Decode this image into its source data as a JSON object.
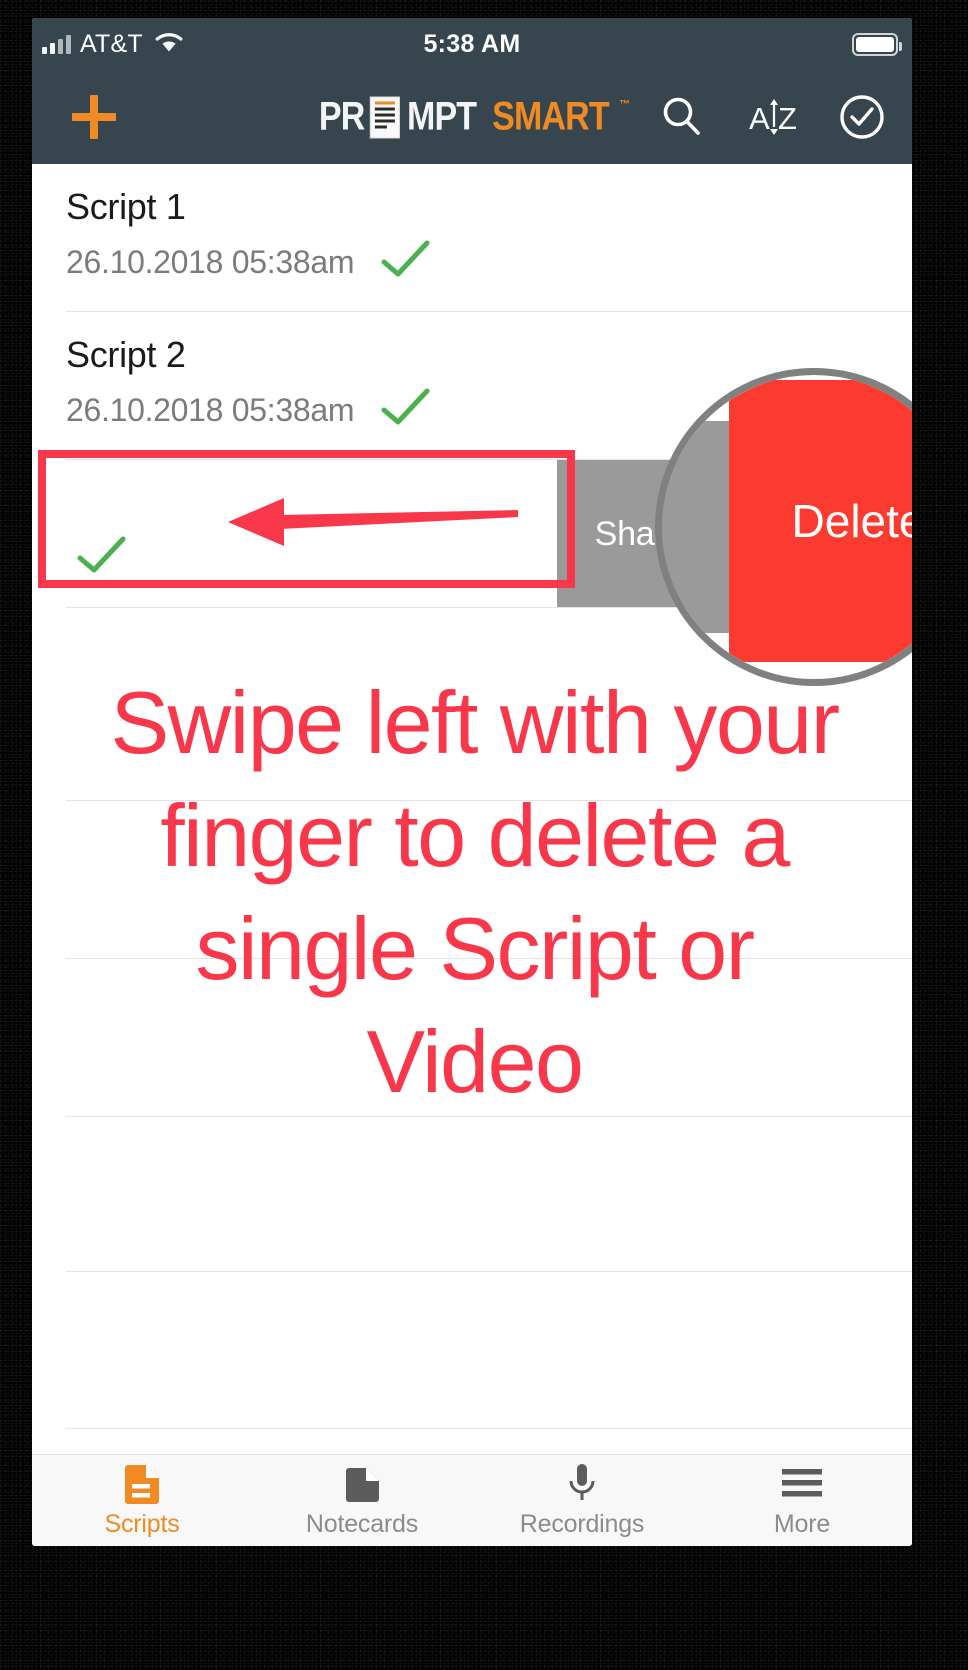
{
  "status_bar": {
    "carrier": "AT&T",
    "time": "5:38 AM",
    "signal_icon": "cellular-signal-icon",
    "wifi_icon": "wifi-icon",
    "battery_icon": "battery-full-icon"
  },
  "nav_bar": {
    "add_label": "+",
    "add_icon": "plus-icon",
    "logo_part1": "PR",
    "logo_doc_icon": "document-icon",
    "logo_part2": "MPT",
    "logo_part3": "SMART",
    "logo_trademark": "™",
    "search_icon": "search-icon",
    "sort_icon": "sort-az-icon",
    "select_icon": "check-circle-icon"
  },
  "scripts": [
    {
      "title": "Script 1",
      "date": "26.10.2018 05:38am",
      "status_icon": "green-check-icon"
    },
    {
      "title": "Script 2",
      "date": "26.10.2018 05:38am",
      "status_icon": "green-check-icon"
    }
  ],
  "swiped_row": {
    "status_icon": "green-check-icon",
    "share_label": "Share",
    "delete_label": "Delete",
    "share_color": "#9a9a9a",
    "delete_color": "#fb3b30"
  },
  "magnifier": {
    "share_label": "Sh",
    "delete_label": "Delete",
    "border_color": "#808080"
  },
  "annotation": {
    "arrow_icon": "left-arrow-icon",
    "highlight_color": "#f8384a",
    "instruction_text": "Swipe left with your finger to delete a single Script or Video"
  },
  "tab_bar": {
    "items": [
      {
        "label": "Scripts",
        "icon": "script-document-icon",
        "active": true
      },
      {
        "label": "Notecards",
        "icon": "notecard-icon",
        "active": false
      },
      {
        "label": "Recordings",
        "icon": "microphone-icon",
        "active": false
      },
      {
        "label": "More",
        "icon": "hamburger-menu-icon",
        "active": false
      }
    ],
    "active_color": "#f08a22",
    "inactive_color": "#8c8c8c"
  }
}
